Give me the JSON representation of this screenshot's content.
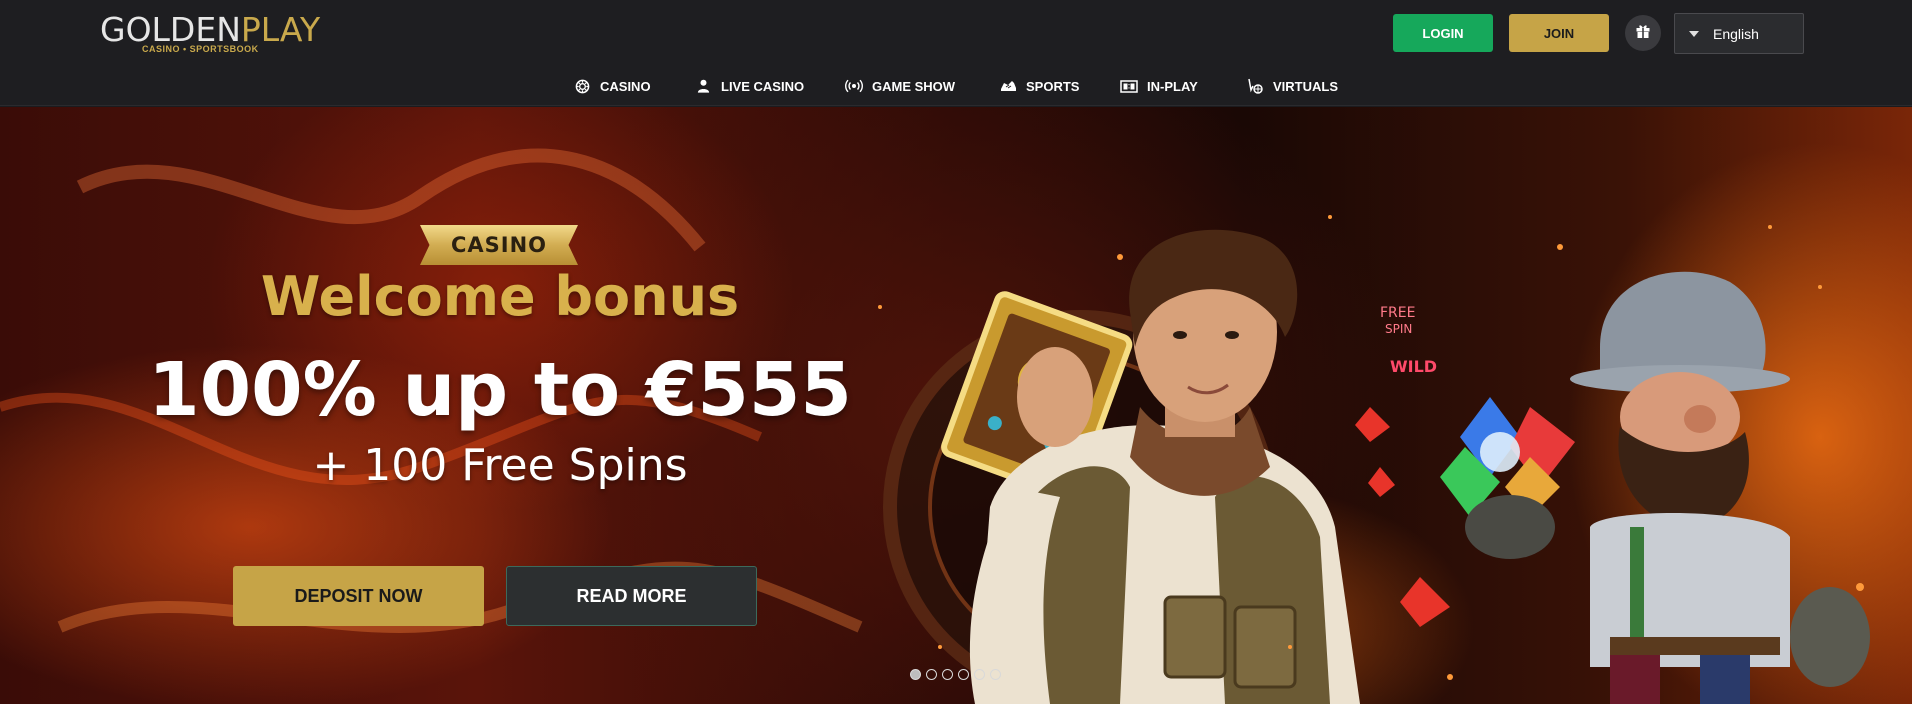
{
  "brand": {
    "logo_main_a": "GOLDEN",
    "logo_main_b": "PLAY",
    "logo_tagline": "CASINO • SPORTSBOOK"
  },
  "header": {
    "login_label": "LOGIN",
    "join_label": "JOIN",
    "gift_icon": "gift-icon",
    "language": {
      "selected": "English",
      "caret_icon": "chevron-down-icon"
    }
  },
  "nav": {
    "items": [
      {
        "label": "CASINO",
        "icon": "casino-chip-icon"
      },
      {
        "label": "LIVE CASINO",
        "icon": "dealer-icon"
      },
      {
        "label": "GAME SHOW",
        "icon": "broadcast-icon"
      },
      {
        "label": "SPORTS",
        "icon": "sports-shoe-icon"
      },
      {
        "label": "IN-PLAY",
        "icon": "scoreboard-icon"
      },
      {
        "label": "VIRTUALS",
        "icon": "virtual-ball-icon"
      }
    ]
  },
  "hero": {
    "ribbon": "CASINO",
    "headline": "Welcome bonus",
    "offer": "100% up to €555",
    "offer_extra": "+ 100 Free Spins",
    "deposit_label": "DEPOSIT NOW",
    "readmore_label": "READ MORE",
    "slides_total": 6,
    "slide_active": 1
  },
  "colors": {
    "header_bg": "#1e1e21",
    "login_green": "#16a85b",
    "gold": "#c6a447",
    "headline_gold": "#d8b14c"
  }
}
